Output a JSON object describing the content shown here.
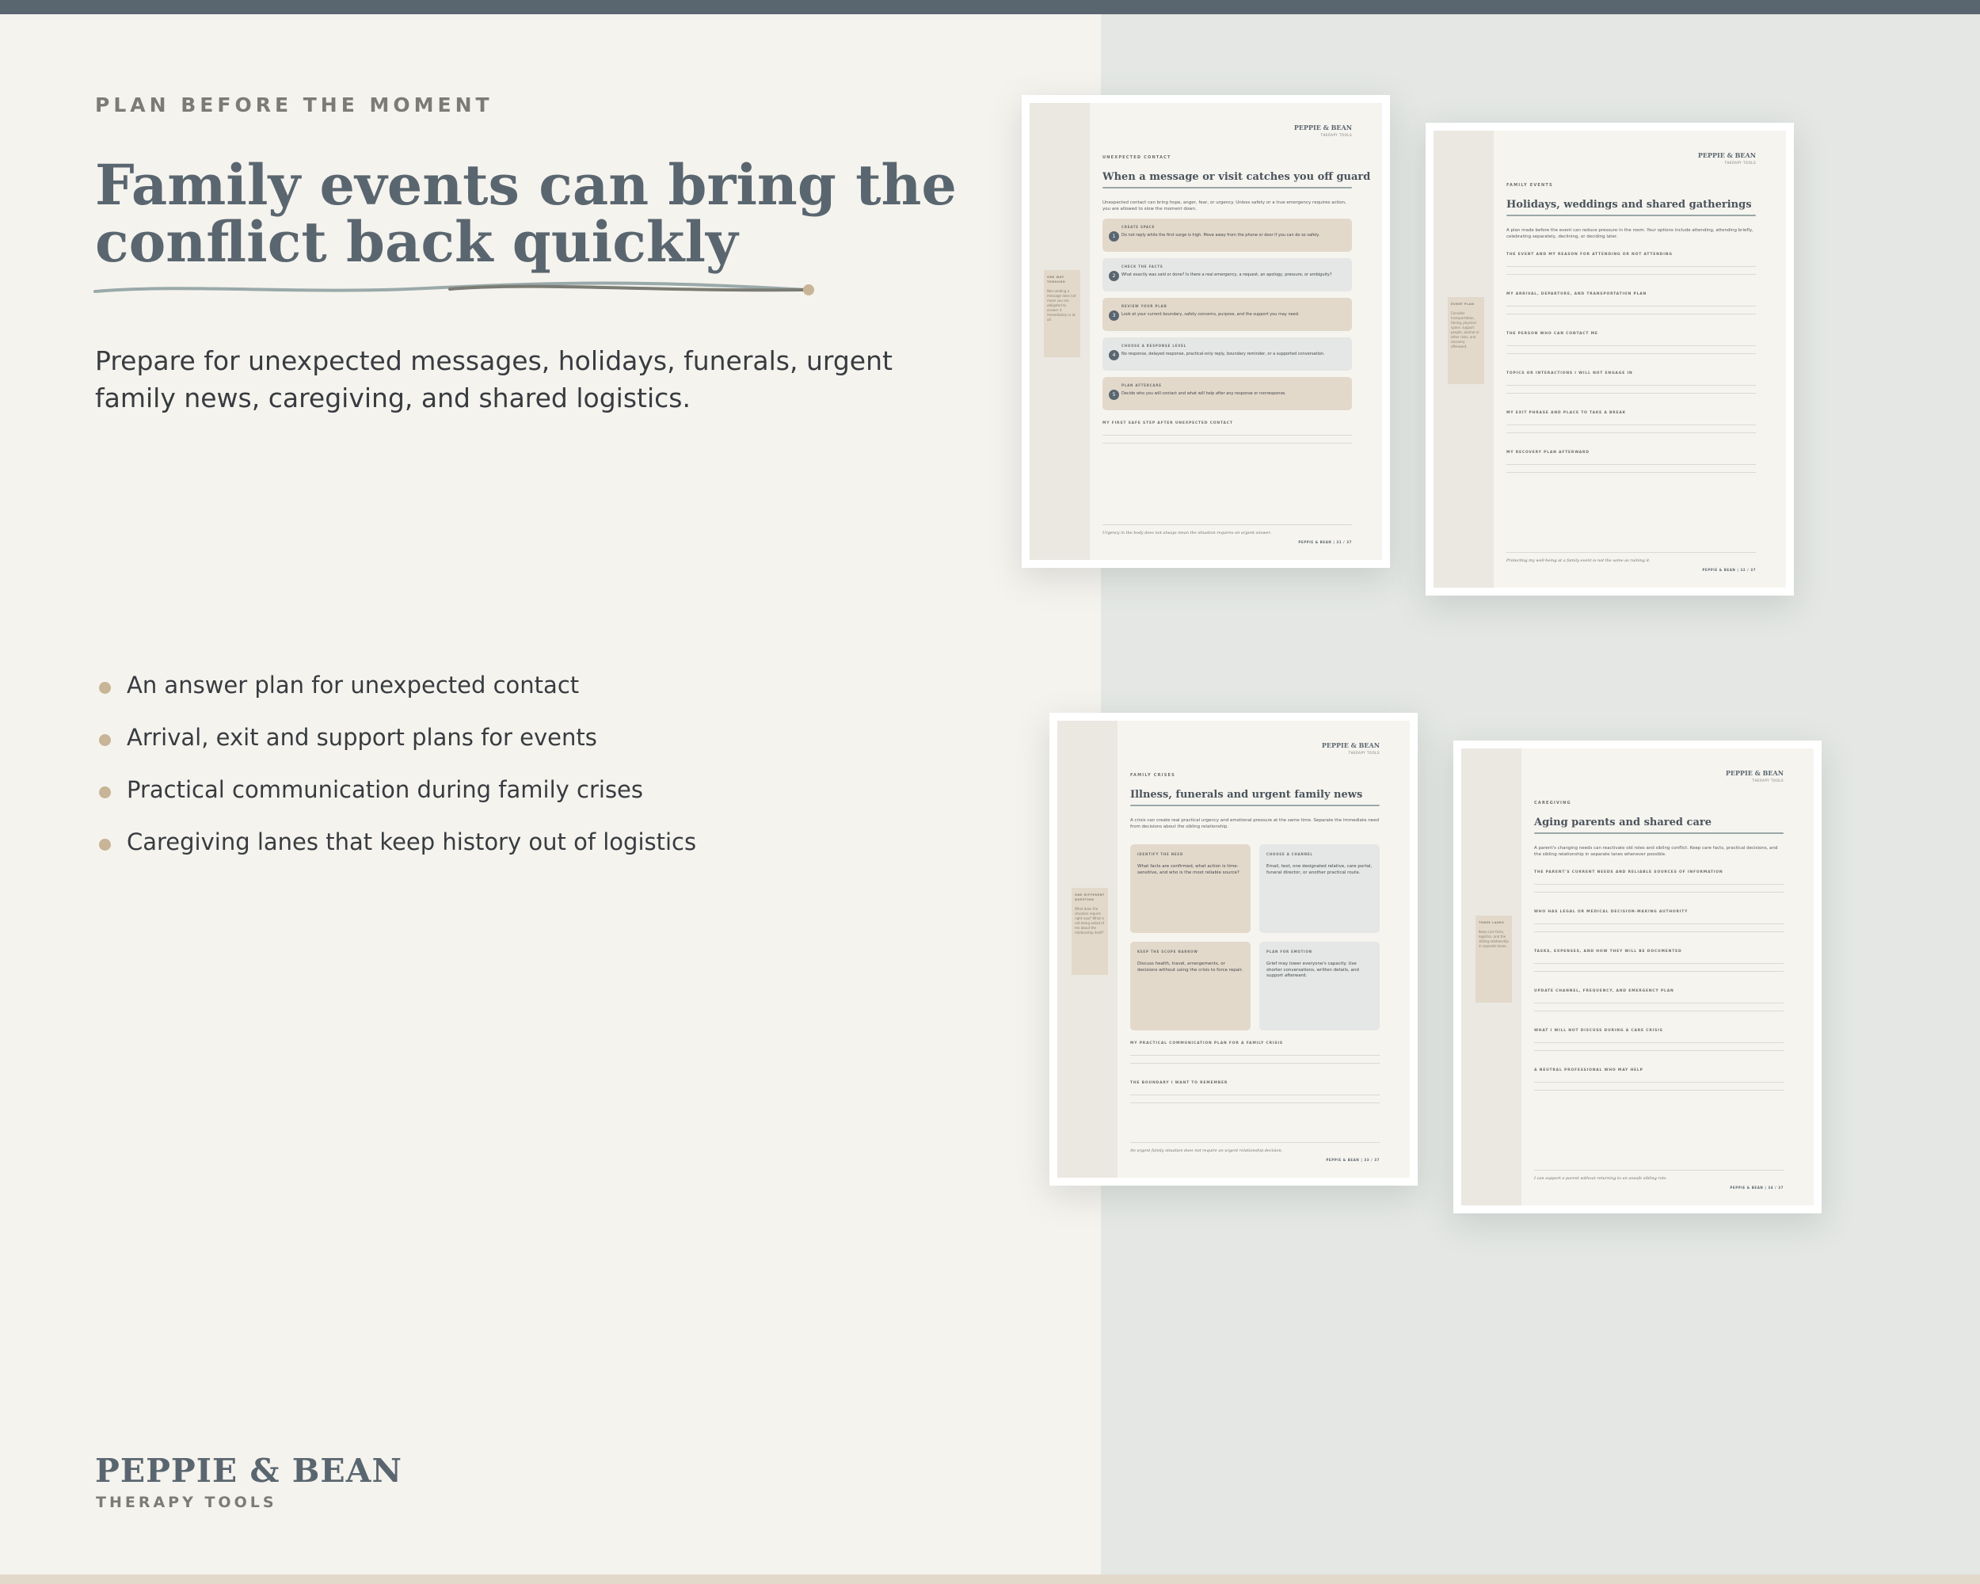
{
  "hero": {
    "eyebrow": "PLAN BEFORE THE MOMENT",
    "headline_line1": "Family events can bring the",
    "headline_line2": "conflict back quickly",
    "lede": "Prepare for unexpected messages, holidays, funerals, urgent family news, caregiving, and shared logistics.",
    "accent_color": "#c8b497"
  },
  "bullets": [
    "An answer plan for unexpected contact",
    "Arrival, exit and support plans for events",
    "Practical communication during family crises",
    "Caregiving lanes that keep history out of logistics"
  ],
  "brand": {
    "name": "PEPPIE & BEAN",
    "tagline": "THERAPY TOOLS"
  },
  "worksheets": {
    "contact": {
      "logo": "PEPPIE & BEAN",
      "logo_sub": "THERAPY TOOLS",
      "kicker": "UNEXPECTED CONTACT",
      "title": "When a message or visit catches you off guard",
      "intro": "Unexpected contact can bring hope, anger, fear, or urgency. Unless safety or a true emergency requires action, you are allowed to slow the moment down.",
      "side_title": "ONE WAY THROUGH",
      "side_text": "Not needing a message does not mean you are obligated to answer it immediately or at all.",
      "steps": [
        {
          "num": "1",
          "label": "CREATE SPACE",
          "text": "Do not reply while the first surge is high. Move away from the phone or door if you can do so safely."
        },
        {
          "num": "2",
          "label": "CHECK THE FACTS",
          "text": "What exactly was said or done? Is there a real emergency, a request, an apology, pressure, or ambiguity?"
        },
        {
          "num": "3",
          "label": "REVIEW YOUR PLAN",
          "text": "Look at your current boundary, safety concerns, purpose, and the support you may need."
        },
        {
          "num": "4",
          "label": "CHOOSE A RESPONSE LEVEL",
          "text": "No response, delayed response, practical-only reply, boundary reminder, or a supported conversation."
        },
        {
          "num": "5",
          "label": "PLAN AFTERCARE",
          "text": "Decide who you will contact and what will help after any response or nonresponse."
        }
      ],
      "field": "MY FIRST SAFE STEP AFTER UNEXPECTED CONTACT",
      "footer": "Urgency in the body does not always mean the situation requires an urgent answer.",
      "page": "PEPPIE & BEAN | 31 / 37"
    },
    "holidays": {
      "logo": "PEPPIE & BEAN",
      "logo_sub": "THERAPY TOOLS",
      "kicker": "FAMILY EVENTS",
      "title": "Holidays, weddings and shared gatherings",
      "intro": "A plan made before the event can reduce pressure in the room. Your options include attending, attending briefly, celebrating separately, declining, or deciding later.",
      "side_title": "EVENT PLAN",
      "side_text": "Consider transportation, timing, physical space, support people, alcohol or other risks, and recovery afterward.",
      "fields": [
        "THE EVENT AND MY REASON FOR ATTENDING OR NOT ATTENDING",
        "MY ARRIVAL, DEPARTURE, AND TRANSPORTATION PLAN",
        "THE PERSON WHO CAN CONTACT ME",
        "TOPICS OR INTERACTIONS I WILL NOT ENGAGE IN",
        "MY EXIT PHRASE AND PLACE TO TAKE A BREAK",
        "MY RECOVERY PLAN AFTERWARD"
      ],
      "footer": "Protecting my well-being at a family event is not the same as ruining it.",
      "page": "PEPPIE & BEAN | 32 / 37"
    },
    "crises": {
      "logo": "PEPPIE & BEAN",
      "logo_sub": "THERAPY TOOLS",
      "kicker": "FAMILY CRISES",
      "title": "Illness, funerals and urgent family news",
      "intro": "A crisis can create real practical urgency and emotional pressure at the same time. Separate the immediate need from decisions about the sibling relationship.",
      "side_title": "ONE DIFFERENT QUESTION",
      "side_text": "What does the situation require right now? What is not being asked of me about the relationship itself?",
      "cells": [
        {
          "label": "IDENTIFY THE NEED",
          "text": "What facts are confirmed, what action is time-sensitive, and who is the most reliable source?",
          "tone": "tan"
        },
        {
          "label": "CHOOSE A CHANNEL",
          "text": "Email, text, one designated relative, care portal, funeral director, or another practical route.",
          "tone": "grey"
        },
        {
          "label": "KEEP THE SCOPE NARROW",
          "text": "Discuss health, travel, arrangements, or decisions without using the crisis to force repair.",
          "tone": "tan"
        },
        {
          "label": "PLAN FOR EMOTION",
          "text": "Grief may lower everyone's capacity. Use shorter conversations, written details, and support afterward.",
          "tone": "grey"
        }
      ],
      "fields": [
        "MY PRACTICAL COMMUNICATION PLAN FOR A FAMILY CRISIS",
        "THE BOUNDARY I WANT TO REMEMBER"
      ],
      "footer": "An urgent family situation does not require an urgent relationship decision.",
      "page": "PEPPIE & BEAN | 33 / 37"
    },
    "caregiving": {
      "logo": "PEPPIE & BEAN",
      "logo_sub": "THERAPY TOOLS",
      "kicker": "CAREGIVING",
      "title": "Aging parents and shared care",
      "intro": "A parent's changing needs can reactivate old roles and sibling conflict. Keep care facts, practical decisions, and the sibling relationship in separate lanes whenever possible.",
      "side_title": "THREE LANES",
      "side_text": "Keep care facts, logistics, and the sibling relationship in separate lanes.",
      "fields": [
        "THE PARENT'S CURRENT NEEDS AND RELIABLE SOURCES OF INFORMATION",
        "WHO HAS LEGAL OR MEDICAL DECISION-MAKING AUTHORITY",
        "TASKS, EXPENSES, AND HOW THEY WILL BE DOCUMENTED",
        "UPDATE CHANNEL, FREQUENCY, AND EMERGENCY PLAN",
        "WHAT I WILL NOT DISCUSS DURING A CARE CRISIS",
        "A NEUTRAL PROFESSIONAL WHO MAY HELP"
      ],
      "footer": "I can support a parent without returning to an unsafe sibling role.",
      "page": "PEPPIE & BEAN | 34 / 37"
    }
  }
}
